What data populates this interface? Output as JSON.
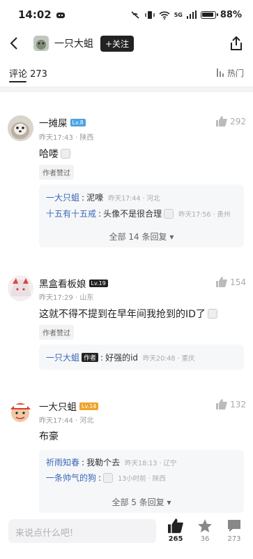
{
  "status_bar": {
    "time": "14:02",
    "battery": "88%",
    "network": "5G"
  },
  "header": {
    "title": "一只大蛆",
    "follow_label": "+关注"
  },
  "tabs": {
    "comments_label": "评论 273",
    "sort_label": "热门"
  },
  "comments": [
    {
      "username": "一摊屎",
      "level": "Lv.8",
      "level_color": "#4aa3df",
      "meta": "昨天17:43 · 陕西",
      "likes": "292",
      "text": "哈喽",
      "badge": "作者赞过",
      "replies": [
        {
          "name": "一大只蛆",
          "text": "泥嚎",
          "meta": "昨天17:44 · 河北"
        },
        {
          "name": "十五有十五戒",
          "text": "头像不是很合理",
          "meta": "昨天17:56 · 贵州"
        }
      ],
      "more": "全部 14 条回复"
    },
    {
      "username": "黑盒看板娘",
      "level": "Lv.19",
      "level_color": "#222222",
      "meta": "昨天17:29 · 山东",
      "likes": "154",
      "text": "这就不得不提到在早年间我抢到的ID了",
      "badge": "作者赞过",
      "replies": [
        {
          "name": "一只大蛆",
          "tag": "作者",
          "text": "好强的id",
          "meta": "昨天20:48 · 重庆"
        }
      ]
    },
    {
      "username": "一大只蛆",
      "level": "Lv.14",
      "level_color": "#f0a32c",
      "meta": "昨天17:44 · 河北",
      "likes": "132",
      "text": "布豪",
      "replies": [
        {
          "name": "祈雨知春",
          "text": "我勒个去",
          "meta": "昨天18:13 · 辽宁"
        },
        {
          "name": "一条帅气的狗",
          "text": "",
          "meta": "13小时前 · 陕西"
        }
      ],
      "more": "全部 5 条回复"
    }
  ],
  "bottom_bar": {
    "placeholder": "来说点什么吧!",
    "likes": "265",
    "stars": "36",
    "comments": "273"
  }
}
